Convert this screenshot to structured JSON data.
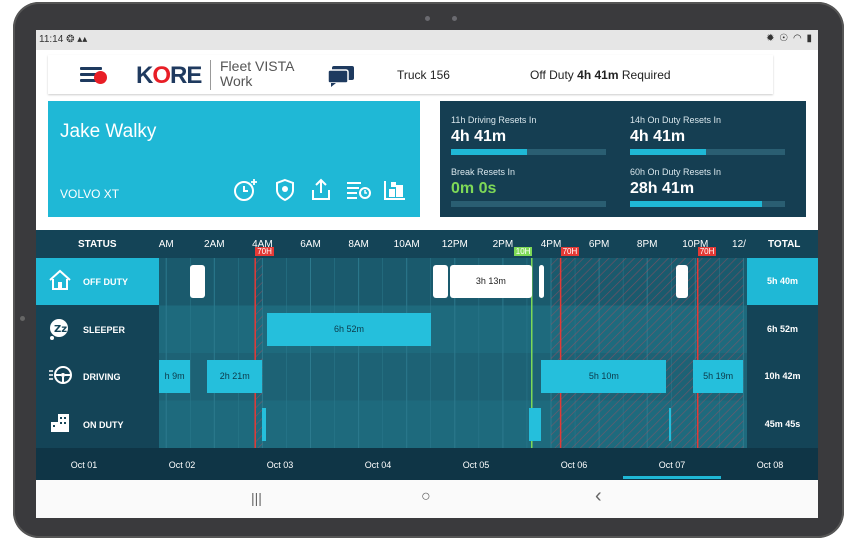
{
  "statusbar": {
    "time": "11:14",
    "indicators": "❂ ▴▴",
    "system": "✹ ☉ ◠ ▮"
  },
  "header": {
    "brand_k": "K",
    "brand_o": "O",
    "brand_rest": "RE",
    "product_line1": "Fleet VISTA",
    "product_line2": "Work",
    "truck": "Truck 156",
    "off_duty_prefix": "Off Duty ",
    "off_duty_hours": "4h",
    "off_duty_minutes": "41m",
    "off_duty_suffix": " Required",
    "icons": [
      "menu-icon",
      "chat-icon"
    ]
  },
  "driver": {
    "name": "Jake Walky",
    "vehicle": "VOLVO XT",
    "icons": [
      "add-time-icon",
      "shield-icon",
      "share-icon",
      "logs-icon",
      "cargo-icon"
    ]
  },
  "resets": [
    {
      "title": "11h Driving Resets In",
      "value": "4h 41m",
      "progress": 0.49,
      "highlight": false
    },
    {
      "title": "14h On Duty Resets In",
      "value": "4h 41m",
      "progress": 0.49,
      "highlight": false
    },
    {
      "title": "Break Resets In",
      "value": "0m 0s",
      "progress": 0.0,
      "highlight": true
    },
    {
      "title": "60h On Duty Resets In",
      "value": "28h 41m",
      "progress": 0.85,
      "highlight": false
    }
  ],
  "colors": {
    "accent": "#1fb8d6",
    "dark_panel": "#153e52",
    "break_green": "#7ed957",
    "limit_red": "#e53935"
  },
  "chart_data": {
    "type": "duty-status-timeline",
    "status_header": "STATUS",
    "total_header": "TOTAL",
    "time_ticks": [
      "AM",
      "2AM",
      "4AM",
      "6AM",
      "8AM",
      "10AM",
      "12PM",
      "2PM",
      "4PM",
      "6PM",
      "8PM",
      "10PM",
      "12/"
    ],
    "tick_hours": [
      0,
      2,
      4,
      6,
      8,
      10,
      12,
      14,
      16,
      18,
      20,
      22,
      24
    ],
    "markers": [
      {
        "label": "70H",
        "hour": 3.7,
        "color": "red"
      },
      {
        "label": "10H",
        "hour": 15.2,
        "color": "green"
      },
      {
        "label": "70H",
        "hour": 16.4,
        "color": "red"
      },
      {
        "label": "70H",
        "hour": 22.1,
        "color": "red"
      }
    ],
    "rows": [
      {
        "name": "OFF DUTY",
        "icon": "house-icon",
        "total": "5h 40m",
        "highlight": true,
        "segments": [
          {
            "start": 1.0,
            "end": 1.6,
            "label": "",
            "style": "white"
          },
          {
            "start": 11.1,
            "end": 11.7,
            "label": "",
            "style": "white"
          },
          {
            "start": 11.8,
            "end": 15.2,
            "label": "3h 13m",
            "style": "white"
          },
          {
            "start": 15.5,
            "end": 15.7,
            "label": "",
            "style": "white"
          },
          {
            "start": 21.2,
            "end": 21.7,
            "label": "",
            "style": "white"
          }
        ]
      },
      {
        "name": "SLEEPER",
        "icon": "sleeper-icon",
        "total": "6h 52m",
        "highlight": false,
        "segments": [
          {
            "start": 4.2,
            "end": 11.0,
            "label": "6h 52m",
            "style": "cyan"
          }
        ]
      },
      {
        "name": "DRIVING",
        "icon": "steering-wheel-icon",
        "total": "10h 42m",
        "highlight": false,
        "segments": [
          {
            "start": -0.5,
            "end": 1.0,
            "label": "h 9m",
            "style": "cyan"
          },
          {
            "start": 1.7,
            "end": 4.0,
            "label": "2h 21m",
            "style": "cyan"
          },
          {
            "start": 15.6,
            "end": 20.8,
            "label": "5h 10m",
            "style": "cyan"
          },
          {
            "start": 21.9,
            "end": 24.0,
            "label": "5h 19m",
            "style": "cyan"
          }
        ]
      },
      {
        "name": "ON DUTY",
        "icon": "building-icon",
        "total": "45m 45s",
        "highlight": false,
        "segments": [
          {
            "start": 4.0,
            "end": 4.15,
            "label": "",
            "style": "cyan"
          },
          {
            "start": 15.1,
            "end": 15.6,
            "label": "",
            "style": "cyan"
          },
          {
            "start": 20.9,
            "end": 21.0,
            "label": "",
            "style": "cyan"
          }
        ]
      }
    ],
    "hatched_ranges": [
      {
        "start": 3.7,
        "end": 4.0
      },
      {
        "start": 16.0,
        "end": 24.0
      }
    ],
    "dates": [
      "Oct 01",
      "Oct 02",
      "Oct 03",
      "Oct 04",
      "Oct 05",
      "Oct 06",
      "Oct 07",
      "Oct 08"
    ],
    "selected_date_index": 6
  },
  "navbar": {
    "recent": "|||",
    "home": "○",
    "back": "‹"
  }
}
